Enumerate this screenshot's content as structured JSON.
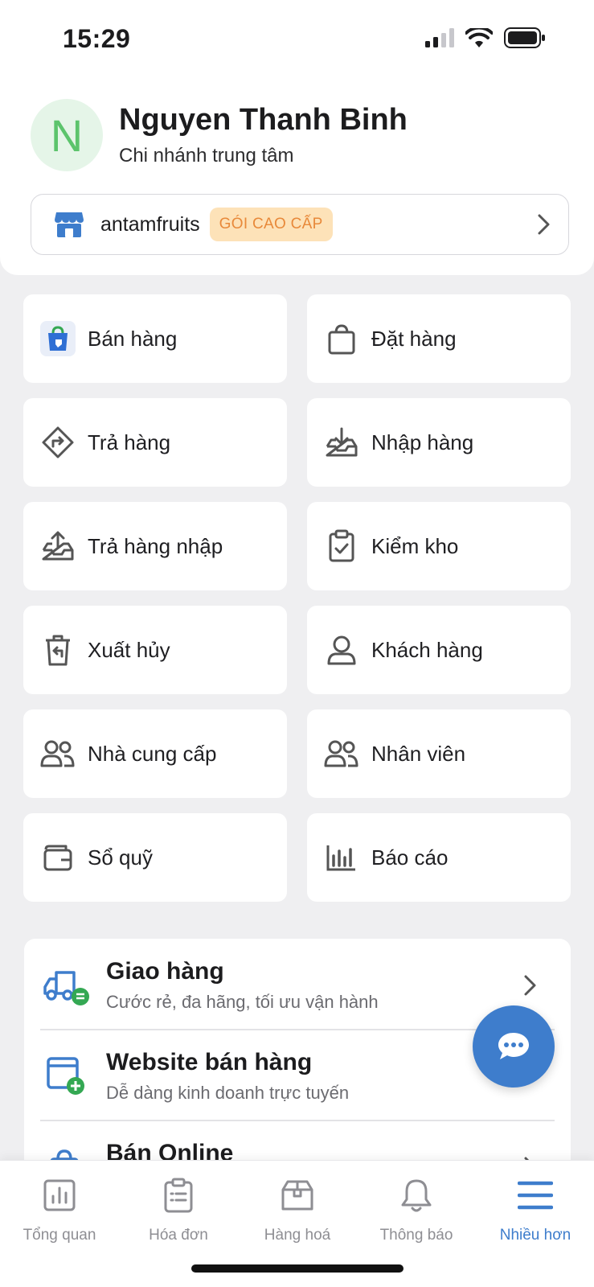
{
  "status_bar": {
    "time": "15:29"
  },
  "profile": {
    "avatar_letter": "N",
    "name": "Nguyen Thanh Binh",
    "branch": "Chi nhánh trung tâm"
  },
  "store": {
    "name": "antamfruits",
    "plan_badge": "GÓI CAO CẤP"
  },
  "menu": {
    "items": [
      {
        "label": "Bán hàng",
        "icon": "shopping-bag-colored-icon"
      },
      {
        "label": "Đặt hàng",
        "icon": "shopping-bag-icon"
      },
      {
        "label": "Trả hàng",
        "icon": "return-arrow-diamond-icon"
      },
      {
        "label": "Nhập hàng",
        "icon": "inbox-download-icon"
      },
      {
        "label": "Trả hàng nhập",
        "icon": "inbox-upload-icon"
      },
      {
        "label": "Kiểm kho",
        "icon": "clipboard-check-icon"
      },
      {
        "label": "Xuất hủy",
        "icon": "trash-return-icon"
      },
      {
        "label": "Khách hàng",
        "icon": "person-icon"
      },
      {
        "label": "Nhà cung cấp",
        "icon": "people-icon"
      },
      {
        "label": "Nhân viên",
        "icon": "people-icon"
      },
      {
        "label": "Sổ quỹ",
        "icon": "wallet-icon"
      },
      {
        "label": "Báo cáo",
        "icon": "bar-chart-icon"
      }
    ]
  },
  "services": [
    {
      "title": "Giao hàng",
      "desc": "Cước rẻ, đa hãng, tối ưu vận hành",
      "icon": "delivery-truck-icon"
    },
    {
      "title": "Website bán hàng",
      "desc": "Dễ dàng kinh doanh trực tuyến",
      "icon": "website-add-icon"
    },
    {
      "title": "Bán Online",
      "desc": "",
      "icon": "online-bag-icon"
    }
  ],
  "tabbar": {
    "tabs": [
      {
        "label": "Tổng quan",
        "icon": "chart-icon"
      },
      {
        "label": "Hóa đơn",
        "icon": "invoice-icon"
      },
      {
        "label": "Hàng hoá",
        "icon": "box-icon"
      },
      {
        "label": "Thông báo",
        "icon": "bell-icon"
      },
      {
        "label": "Nhiều hơn",
        "icon": "menu-icon"
      }
    ],
    "active_index": 4
  },
  "colors": {
    "primary": "#3e7dcc",
    "badge_bg": "#fde2b8",
    "badge_text": "#e8893a",
    "avatar_bg": "#e5f5e8",
    "avatar_text": "#5cc46c",
    "background": "#efeff1"
  }
}
